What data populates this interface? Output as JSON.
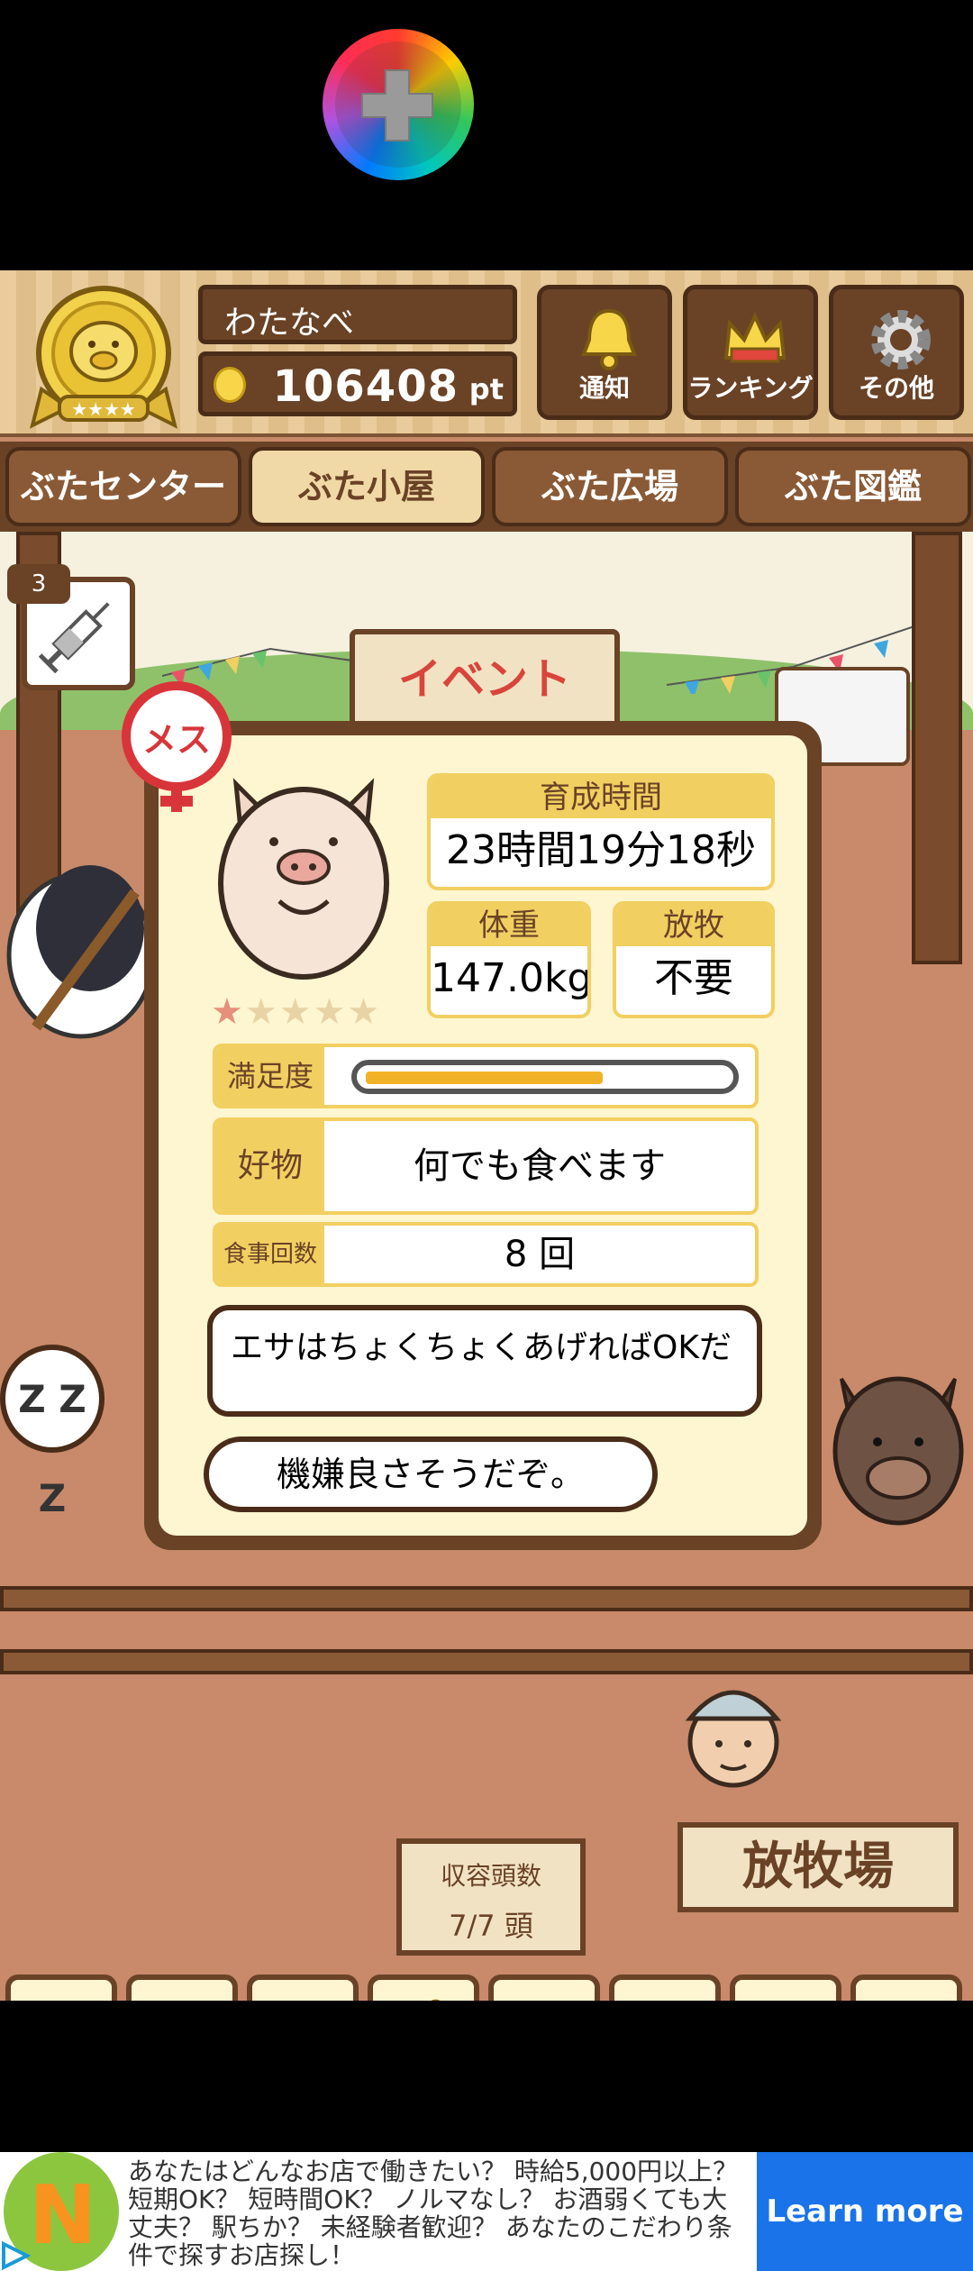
{
  "header": {
    "player_name": "わたなべ",
    "points": "106408",
    "points_unit": "pt",
    "buttons": [
      {
        "label": "通知",
        "icon": "bell-icon"
      },
      {
        "label": "ランキング",
        "icon": "crown-icon"
      },
      {
        "label": "その他",
        "icon": "gear-icon"
      }
    ]
  },
  "tabs": [
    "ぶたセンター",
    "ぶた小屋",
    "ぶた広場",
    "ぶた図鑑"
  ],
  "active_tab": "ぶた小屋",
  "scene": {
    "needle_count": "3",
    "event_sign": "イベント",
    "sleep_bubble": "Z Z Z",
    "capacity_label": "収容頭数",
    "capacity_value": "7/7 頭",
    "pasture_sign": "放牧場"
  },
  "pig": {
    "gender_label": "メス",
    "stars_filled": 1,
    "stars_total": 5,
    "growth_time_label": "育成時間",
    "growth_time_value": "23時間19分18秒",
    "weight_label": "体重",
    "weight_value": "147.0kg",
    "grazing_label": "放牧",
    "grazing_value": "不要",
    "satisfaction_label": "満足度",
    "satisfaction_level": 0.66,
    "favorite_label": "好物",
    "favorite_value": "何でも食べます",
    "meals_label": "食事回数",
    "meals_value": "8 回",
    "advice": "エサはちょくちょくあげればOKだ",
    "mood": "機嫌良さそうだぞ。"
  },
  "foods": [
    {
      "icon": "grain-pile-icon"
    },
    {
      "icon": "mixed-grain-icon"
    },
    {
      "icon": "sweet-potato-icon"
    },
    {
      "icon": "corn-icon"
    },
    {
      "icon": "herb-berries-icon"
    },
    {
      "icon": "acorn-icon"
    },
    {
      "icon": "grain-bowl-icon"
    },
    {
      "icon": "meatball-plate-icon"
    }
  ],
  "ad": {
    "text": "あなたはどんなお店で働きたい？ 時給5,000円以上？ 短期OK？ 短時間OK？ ノルマなし？ お酒弱くても大丈夫？ 駅ちか？ 未経験者歓迎？ あなたのこだわり条件で探すお店探し！",
    "button": "Learn more",
    "logo_letter": "N"
  },
  "colors": {
    "wood_dark": "#6a4226",
    "wood_light": "#e6c48e",
    "panel_cream": "#fdf6d0",
    "label_yellow": "#f2cf61",
    "ad_button": "#1a73e8"
  }
}
